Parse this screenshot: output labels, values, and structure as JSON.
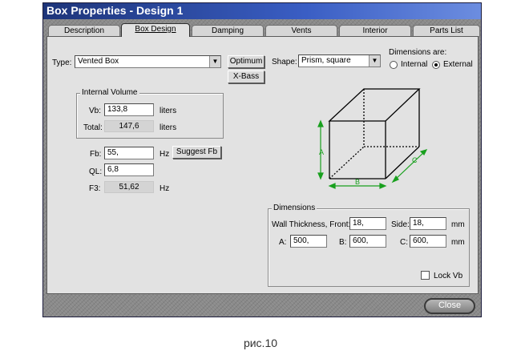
{
  "window": {
    "title": "Box Properties - Design 1",
    "tabs": [
      "Description",
      "Box Design",
      "Damping",
      "Vents",
      "Interior",
      "Parts List"
    ],
    "active_tab": "Box Design"
  },
  "type": {
    "label": "Type:",
    "value": "Vented Box",
    "optimum_label": "Optimum",
    "xbass_label": "X-Bass"
  },
  "shape": {
    "label": "Shape:",
    "value": "Prism, square"
  },
  "dimensions_are": {
    "label": "Dimensions are:",
    "internal_label": "Internal",
    "external_label": "External",
    "selected": "External"
  },
  "internal_volume": {
    "title": "Internal Volume",
    "vb_label": "Vb:",
    "vb_value": "133,8",
    "vb_unit": "liters",
    "total_label": "Total:",
    "total_value": "147,6",
    "total_unit": "liters"
  },
  "tuning": {
    "fb_label": "Fb:",
    "fb_value": "55,",
    "fb_unit": "Hz",
    "suggest_label": "Suggest Fb",
    "ql_label": "QL:",
    "ql_value": "6,8",
    "f3_label": "F3:",
    "f3_value": "51,62",
    "f3_unit": "Hz"
  },
  "diagram": {
    "label_a": "A",
    "label_b": "B",
    "label_c": "C",
    "dim_color": "#19a01e"
  },
  "dimensions": {
    "title": "Dimensions",
    "wall_front_label": "Wall Thickness, Front:",
    "wall_front_value": "18,",
    "side_label": "Side:",
    "side_value": "18,",
    "unit": "mm",
    "a_label": "A:",
    "a_value": "500,",
    "b_label": "B:",
    "b_value": "600,",
    "c_label": "C:",
    "c_value": "600,",
    "lock_label": "Lock Vb",
    "lock_checked": false
  },
  "close_label": "Close",
  "caption": "рис.10"
}
